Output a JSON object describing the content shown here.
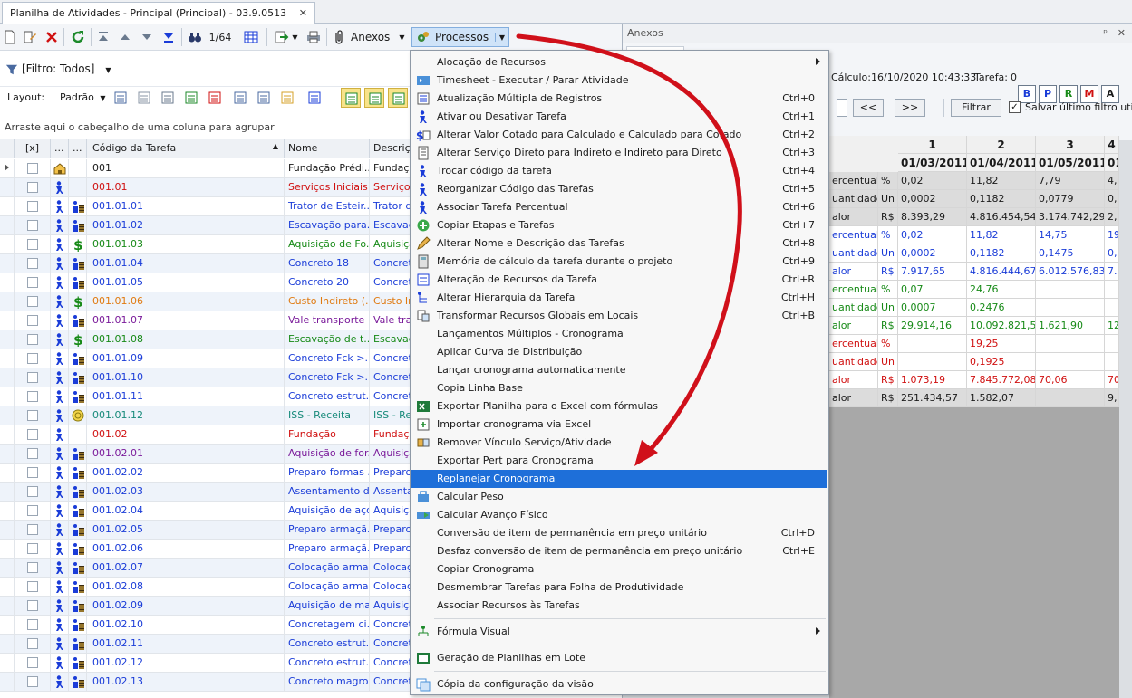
{
  "window": {
    "tab_title": "Planilha de Atividades - Principal (Principal) - 03.9.0513",
    "tab_close": "✕"
  },
  "toolbar": {
    "record_counter": "1/64",
    "anexos_label": "Anexos",
    "processos_label": "Processos"
  },
  "filter": {
    "label": "[Filtro: Todos]"
  },
  "layout": {
    "label": "Layout:",
    "preset": "Padrão"
  },
  "group_panel": {
    "text": "Arraste aqui o cabeçalho de uma coluna para agrupar"
  },
  "grid": {
    "columns": [
      "[x]",
      "...",
      "...",
      "Código da Tarefa",
      "Nome",
      "Descriç"
    ],
    "rows": [
      {
        "code": "001",
        "name": "Fundação Prédi...",
        "desc": "Fundaçã",
        "color": "#1a1a1a",
        "icon": "house-icon"
      },
      {
        "code": "001.01",
        "name": "Serviços Iniciais",
        "desc": "Serviços",
        "color": "#d01010",
        "icon": "worker-icon"
      },
      {
        "code": "001.01.01",
        "name": "Trator de Esteir...",
        "desc": "Trator d",
        "color": "#1a3cd8",
        "icon": "resource-group-icon"
      },
      {
        "code": "001.01.02",
        "name": "Escavação para...",
        "desc": "Escavaç",
        "color": "#1a3cd8",
        "icon": "resource-group-icon"
      },
      {
        "code": "001.01.03",
        "name": "Aquisição de Fo...",
        "desc": "Aquisiçã",
        "color": "#178a17",
        "icon": "money-icon"
      },
      {
        "code": "001.01.04",
        "name": "Concreto 18",
        "desc": "Concret",
        "color": "#1a3cd8",
        "icon": "resource-group-icon"
      },
      {
        "code": "001.01.05",
        "name": "Concreto 20",
        "desc": "Concret",
        "color": "#1a3cd8",
        "icon": "resource-group-icon"
      },
      {
        "code": "001.01.06",
        "name": "Custo Indireto (...",
        "desc": "Custo In",
        "color": "#e07a10",
        "icon": "money-icon"
      },
      {
        "code": "001.01.07",
        "name": "Vale transporte",
        "desc": "Vale tra",
        "color": "#7a1a9a",
        "icon": "resource-group-icon"
      },
      {
        "code": "001.01.08",
        "name": "Escavação de t...",
        "desc": "Escavaç",
        "color": "#178a17",
        "icon": "money-icon"
      },
      {
        "code": "001.01.09",
        "name": "Concreto Fck >...",
        "desc": "Concret",
        "color": "#1a3cd8",
        "icon": "resource-group-icon"
      },
      {
        "code": "001.01.10",
        "name": "Concreto Fck >...",
        "desc": "Concret",
        "color": "#1a3cd8",
        "icon": "resource-group-icon"
      },
      {
        "code": "001.01.11",
        "name": "Concreto estrut...",
        "desc": "Concret",
        "color": "#1a3cd8",
        "icon": "resource-group-icon"
      },
      {
        "code": "001.01.12",
        "name": "ISS - Receita",
        "desc": "ISS - Re",
        "color": "#178a7a",
        "icon": "coin-icon"
      },
      {
        "code": "001.02",
        "name": "Fundação",
        "desc": "Fundaçã",
        "color": "#d01010",
        "icon": "worker-icon"
      },
      {
        "code": "001.02.01",
        "name": "Aquisição de for...",
        "desc": "Aquisiçã",
        "color": "#7a1a9a",
        "icon": "resource-group-icon"
      },
      {
        "code": "001.02.02",
        "name": "Preparo formas ...",
        "desc": "Preparo",
        "color": "#1a3cd8",
        "icon": "resource-group-icon"
      },
      {
        "code": "001.02.03",
        "name": "Assentamento d...",
        "desc": "Assenta",
        "color": "#1a3cd8",
        "icon": "resource-group-icon"
      },
      {
        "code": "001.02.04",
        "name": "Aquisição de aço",
        "desc": "Aquisiçã",
        "color": "#1a3cd8",
        "icon": "resource-group-icon"
      },
      {
        "code": "001.02.05",
        "name": "Preparo armaçã...",
        "desc": "Preparo",
        "color": "#1a3cd8",
        "icon": "resource-group-icon"
      },
      {
        "code": "001.02.06",
        "name": "Preparo armaçã...",
        "desc": "Preparo",
        "color": "#1a3cd8",
        "icon": "resource-group-icon"
      },
      {
        "code": "001.02.07",
        "name": "Colocação arma...",
        "desc": "Colocaç",
        "color": "#1a3cd8",
        "icon": "resource-group-icon"
      },
      {
        "code": "001.02.08",
        "name": "Colocação arma...",
        "desc": "Colocaç",
        "color": "#1a3cd8",
        "icon": "resource-group-icon"
      },
      {
        "code": "001.02.09",
        "name": "Aquisição de ma...",
        "desc": "Aquisiçã",
        "color": "#1a3cd8",
        "icon": "resource-group-icon"
      },
      {
        "code": "001.02.10",
        "name": "Concretagem ci...",
        "desc": "Concret",
        "color": "#1a3cd8",
        "icon": "resource-group-icon"
      },
      {
        "code": "001.02.11",
        "name": "Concreto estrut...",
        "desc": "Concret",
        "color": "#1a3cd8",
        "icon": "resource-group-icon"
      },
      {
        "code": "001.02.12",
        "name": "Concreto estrut...",
        "desc": "Concret",
        "color": "#1a3cd8",
        "icon": "resource-group-icon"
      },
      {
        "code": "001.02.13",
        "name": "Concreto magro...",
        "desc": "Concret",
        "color": "#1a3cd8",
        "icon": "resource-group-icon"
      }
    ]
  },
  "anexos_panel": {
    "title": "Anexos",
    "pin": "ᵖ",
    "close": "✕",
    "calc_label": "Cálculo:",
    "calc_value": "16/10/2020 10:43:33",
    "tarefa_label": "Tarefa:",
    "tarefa_value": "0",
    "tarefa_buttons": [
      {
        "label": "B",
        "color": "#1a3cd8"
      },
      {
        "label": "P",
        "color": "#1a3cd8"
      },
      {
        "label": "R",
        "color": "#178a17"
      },
      {
        "label": "M",
        "color": "#d01010"
      },
      {
        "label": "A",
        "color": "#1a1a1a"
      }
    ],
    "prev": "<<",
    "next": ">>",
    "filtrar": "Filtrar",
    "salvar": "Salvar último filtro utiliz",
    "col_numbers": [
      "1",
      "2",
      "3",
      "4"
    ],
    "col_dates": [
      "01/03/2011",
      "01/04/2011",
      "01/05/2011",
      "01"
    ],
    "rows": [
      {
        "label": "ercentual",
        "unit": "%",
        "v": [
          "0,02",
          "11,82",
          "7,79",
          "4,"
        ],
        "color": "#1a1a1a",
        "bg": "#dcdcdc"
      },
      {
        "label": "uantidade",
        "unit": "Un",
        "v": [
          "0,0002",
          "0,1182",
          "0,0779",
          "0,"
        ],
        "color": "#1a1a1a",
        "bg": "#dcdcdc"
      },
      {
        "label": "alor",
        "unit": "R$",
        "v": [
          "8.393,29",
          "4.816.454,54",
          "3.174.742,29",
          "2,"
        ],
        "color": "#1a1a1a",
        "bg": "#dcdcdc"
      },
      {
        "label": "ercentual",
        "unit": "%",
        "v": [
          "0,02",
          "11,82",
          "14,75",
          "19"
        ],
        "color": "#1a3cd8",
        "bg": "#ffffff"
      },
      {
        "label": "uantidade",
        "unit": "Un",
        "v": [
          "0,0002",
          "0,1182",
          "0,1475",
          "0,"
        ],
        "color": "#1a3cd8",
        "bg": "#ffffff"
      },
      {
        "label": "alor",
        "unit": "R$",
        "v": [
          "7.917,65",
          "4.816.444,67",
          "6.012.576,83",
          "7."
        ],
        "color": "#1a3cd8",
        "bg": "#ffffff"
      },
      {
        "label": "ercentual",
        "unit": "%",
        "v": [
          "0,07",
          "24,76",
          "",
          ""
        ],
        "color": "#178a17",
        "bg": "#ffffff"
      },
      {
        "label": "uantidade",
        "unit": "Un",
        "v": [
          "0,0007",
          "0,2476",
          "",
          ""
        ],
        "color": "#178a17",
        "bg": "#ffffff"
      },
      {
        "label": "alor",
        "unit": "R$",
        "v": [
          "29.914,16",
          "10.092.821,56",
          "1.621,90",
          "12"
        ],
        "color": "#178a17",
        "bg": "#ffffff"
      },
      {
        "label": "ercentual",
        "unit": "%",
        "v": [
          "",
          "19,25",
          "",
          ""
        ],
        "color": "#d01010",
        "bg": "#ffffff"
      },
      {
        "label": "uantidade",
        "unit": "Un",
        "v": [
          "",
          "0,1925",
          "",
          ""
        ],
        "color": "#d01010",
        "bg": "#ffffff"
      },
      {
        "label": "alor",
        "unit": "R$",
        "v": [
          "1.073,19",
          "7.845.772,08",
          "70,06",
          "70"
        ],
        "color": "#d01010",
        "bg": "#ffffff"
      },
      {
        "label": "alor",
        "unit": "R$",
        "v": [
          "251.434,57",
          "1.582,07",
          "",
          "9,"
        ],
        "color": "#1a1a1a",
        "bg": "#dcdcdc"
      }
    ]
  },
  "menu": {
    "items": [
      {
        "label": "Alocação de Recursos",
        "shortcut": "",
        "submenu": true,
        "icon": ""
      },
      {
        "label": "Timesheet - Executar / Parar Atividade",
        "shortcut": "",
        "icon": "timesheet-icon"
      },
      {
        "label": "Atualização Múltipla de Registros",
        "shortcut": "Ctrl+0",
        "icon": "multi-update-icon"
      },
      {
        "label": "Ativar ou Desativar Tarefa",
        "shortcut": "Ctrl+1",
        "icon": "worker-icon"
      },
      {
        "label": "Alterar Valor Cotado para Calculado e Calculado para Cotado",
        "shortcut": "Ctrl+2",
        "icon": "money-swap-icon"
      },
      {
        "label": "Alterar Serviço Direto para Indireto e Indireto para Direto",
        "shortcut": "Ctrl+3",
        "icon": "list-icon"
      },
      {
        "label": "Trocar código da tarefa",
        "shortcut": "Ctrl+4",
        "icon": "worker-icon"
      },
      {
        "label": "Reorganizar Código das Tarefas",
        "shortcut": "Ctrl+5",
        "icon": "worker-icon"
      },
      {
        "label": "Associar Tarefa Percentual",
        "shortcut": "Ctrl+6",
        "icon": "worker-icon"
      },
      {
        "label": "Copiar Etapas e Tarefas",
        "shortcut": "Ctrl+7",
        "icon": "plus-circle-icon"
      },
      {
        "label": "Alterar Nome e Descrição das Tarefas",
        "shortcut": "Ctrl+8",
        "icon": "pencil-icon"
      },
      {
        "label": "Memória de cálculo da tarefa durante o projeto",
        "shortcut": "Ctrl+9",
        "icon": "calculator-icon"
      },
      {
        "label": "Alteração de Recursos da Tarefa",
        "shortcut": "Ctrl+R",
        "icon": "resource-icon"
      },
      {
        "label": "Alterar Hierarquia da Tarefa",
        "shortcut": "Ctrl+H",
        "icon": "hierarchy-icon"
      },
      {
        "label": "Transformar Recursos Globais em Locais",
        "shortcut": "Ctrl+B",
        "icon": "transform-icon"
      },
      {
        "label": "Lançamentos Múltiplos - Cronograma",
        "shortcut": "",
        "icon": ""
      },
      {
        "label": "Aplicar Curva de Distribuição",
        "shortcut": "",
        "icon": ""
      },
      {
        "label": "Lançar cronograma automaticamente",
        "shortcut": "",
        "icon": ""
      },
      {
        "label": "Copia Linha Base",
        "shortcut": "",
        "icon": ""
      },
      {
        "label": "Exportar Planilha para o Excel com fórmulas",
        "shortcut": "",
        "icon": "excel-icon"
      },
      {
        "label": "Importar cronograma via Excel",
        "shortcut": "",
        "icon": "import-icon"
      },
      {
        "label": "Remover Vínculo Serviço/Atividade",
        "shortcut": "",
        "icon": "unlink-icon"
      },
      {
        "label": "Exportar Pert para Cronograma",
        "shortcut": "",
        "icon": ""
      },
      {
        "label": "Replanejar Cronograma",
        "shortcut": "",
        "icon": "",
        "highlighted": true
      },
      {
        "label": "Calcular Peso",
        "shortcut": "",
        "icon": "weight-icon"
      },
      {
        "label": "Calcular Avanço Físico",
        "shortcut": "",
        "icon": "progress-icon"
      },
      {
        "label": "Conversão de item de permanência em preço unitário",
        "shortcut": "Ctrl+D",
        "icon": ""
      },
      {
        "label": "Desfaz conversão de item de permanência em preço unitário",
        "shortcut": "Ctrl+E",
        "icon": ""
      },
      {
        "label": "Copiar Cronograma",
        "shortcut": "",
        "icon": ""
      },
      {
        "label": "Desmembrar Tarefas para Folha de Produtividade",
        "shortcut": "",
        "icon": ""
      },
      {
        "label": "Associar Recursos às Tarefas",
        "shortcut": "",
        "icon": ""
      }
    ],
    "tail": [
      {
        "label": "Fórmula Visual",
        "submenu": true,
        "icon": "formula-icon"
      },
      {
        "label": "Geração de Planilhas em Lote",
        "icon": "batch-icon"
      },
      {
        "label": "Cópia da configuração da visão",
        "icon": "copy-view-icon"
      }
    ]
  },
  "accent": {
    "highlight": "#1e6fd9",
    "arrow": "#d0101a"
  }
}
